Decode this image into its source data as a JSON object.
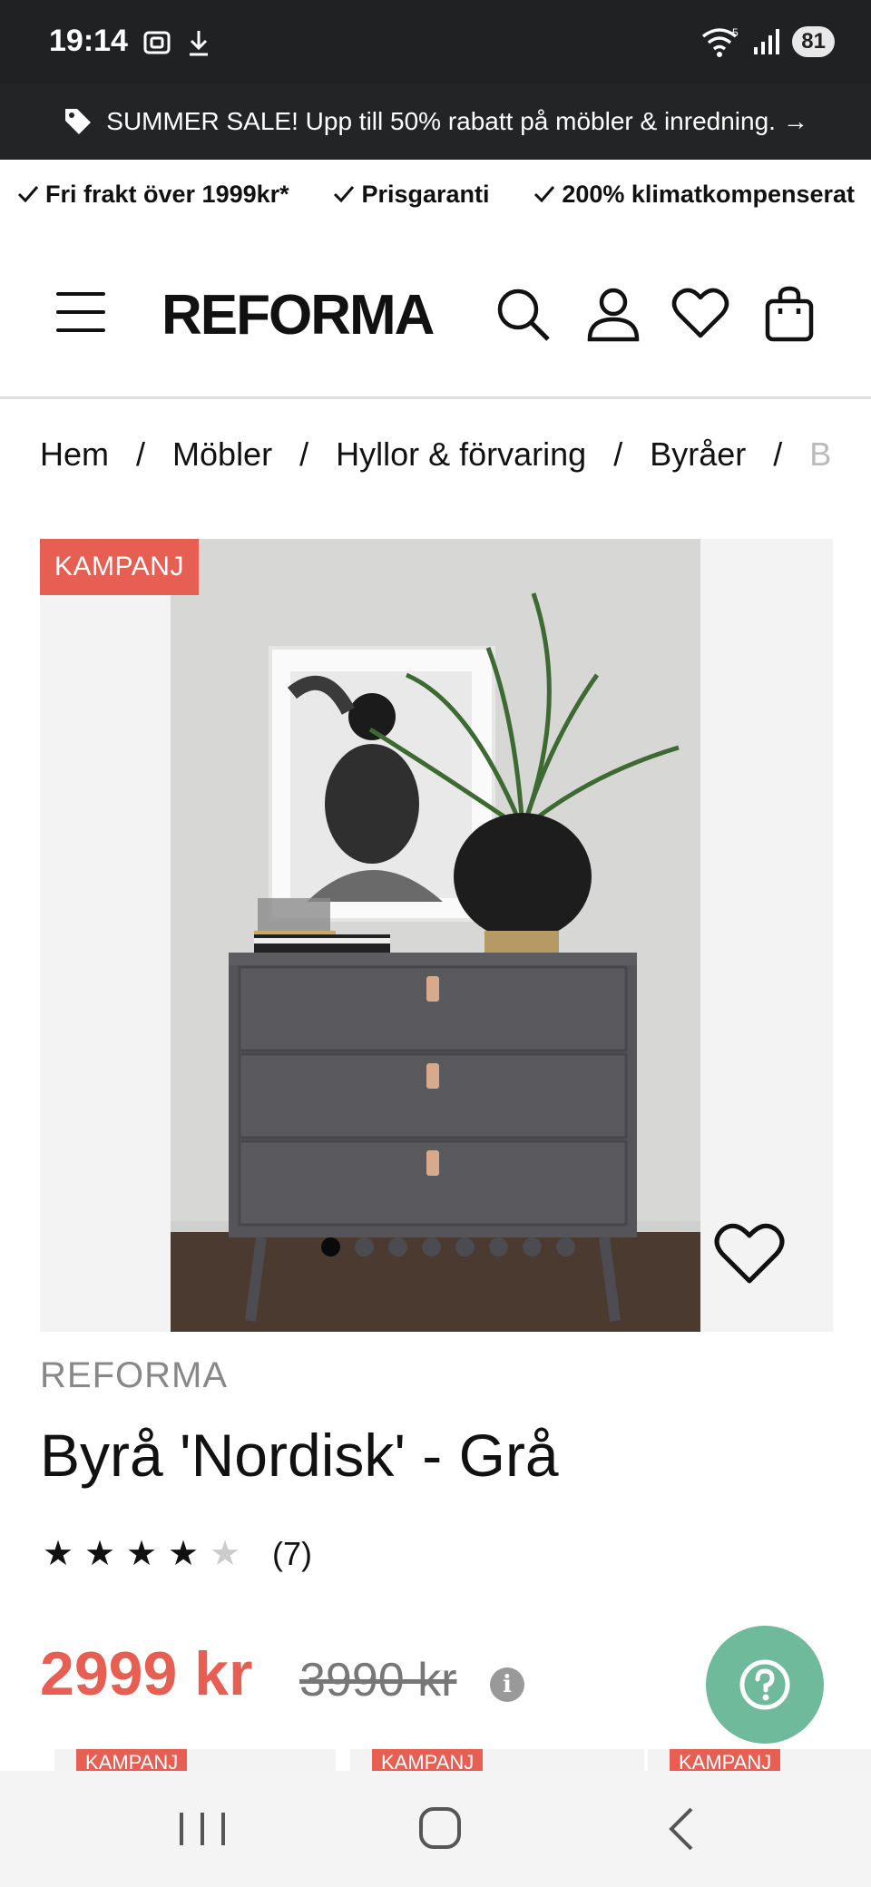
{
  "status": {
    "time": "19:14",
    "battery": "81",
    "wifi_badge": "5"
  },
  "promo": {
    "text": "SUMMER SALE! Upp till 50% rabatt på möbler & inredning. →"
  },
  "usps": [
    "Fri frakt över 1999kr*",
    "Prisgaranti",
    "200% klimatkompenserat"
  ],
  "header": {
    "logo": "REFORMA"
  },
  "breadcrumb": [
    "Hem",
    "Möbler",
    "Hyllor & förvaring",
    "Byråer",
    "B"
  ],
  "product": {
    "badge": "KAMPANJ",
    "brand": "REFORMA",
    "title": "Byrå 'Nordisk' - Grå",
    "rating": 4,
    "rating_max": 5,
    "review_count": "(7)",
    "price": "2999 kr",
    "old_price": "3990 kr",
    "image_count": 8,
    "active_image": 1
  },
  "teasers": [
    {
      "badge": "KAMPANJ"
    },
    {
      "badge": "KAMPANJ"
    },
    {
      "badge": "KAMPANJ"
    }
  ],
  "colors": {
    "accent": "#e75e52",
    "help": "#6fba9a",
    "dark_bar": "#222425"
  },
  "icons": [
    "tag-icon",
    "check-icon",
    "menu-icon",
    "search-icon",
    "user-icon",
    "heart-icon",
    "cart-icon",
    "info-icon",
    "help-icon",
    "recents-icon",
    "home-icon",
    "back-icon"
  ]
}
